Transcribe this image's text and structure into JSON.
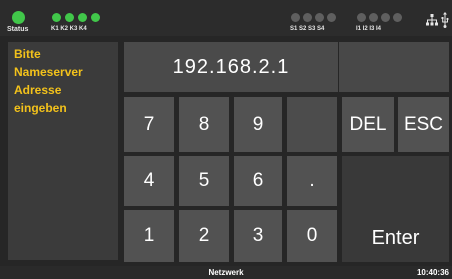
{
  "colors": {
    "led_on": "#41c74a",
    "led_off": "#5f5f5f",
    "message_text": "#f3c21b",
    "key_bg": "#525252",
    "panel_bg": "#3b3b3b"
  },
  "status_bar": {
    "status_label": "Status",
    "channel_labels": "K1 K2 K3 K4",
    "s_labels": "S1 S2 S3 S4",
    "i_labels": "I1 I2 I3 I4",
    "icons": [
      "network-icon",
      "usb-icon"
    ]
  },
  "message": {
    "lines": [
      "Bitte",
      "Nameserver",
      "Adresse",
      "eingeben"
    ]
  },
  "display": {
    "value": "192.168.2.1"
  },
  "keypad": {
    "k7": "7",
    "k8": "8",
    "k9": "9",
    "k4": "4",
    "k5": "5",
    "k6": "6",
    "dot": ".",
    "k1": "1",
    "k2": "2",
    "k3": "3",
    "k0": "0",
    "del": "DEL",
    "esc": "ESC",
    "enter": "Enter"
  },
  "footer": {
    "title": "Netzwerk",
    "time": "10:40:36"
  }
}
